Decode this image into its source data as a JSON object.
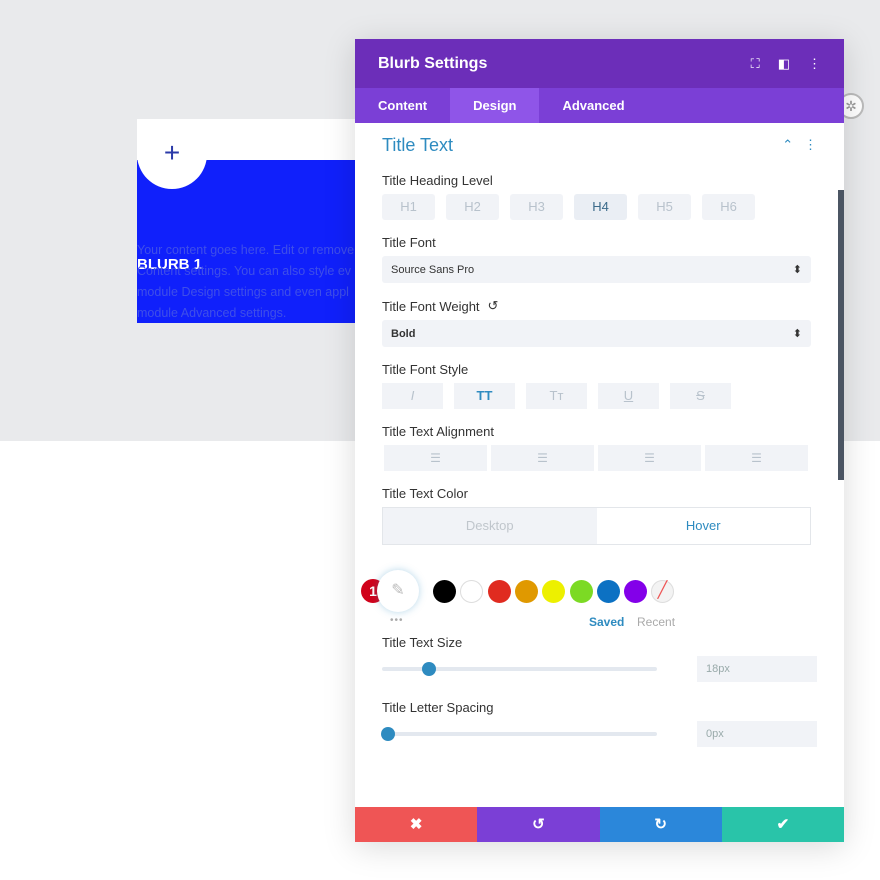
{
  "page": {
    "blurb_title": "BLURB 1",
    "blurb_lines": [
      "Your content goes here. Edit or remove",
      "Content settings. You can also style ev",
      "module Design settings and even appl",
      "module Advanced settings."
    ],
    "plus": "+"
  },
  "panel": {
    "title": "Blurb Settings",
    "tabs": [
      "Content",
      "Design",
      "Advanced"
    ],
    "active_tab": "Design",
    "section": "Title Text",
    "heading_label": "Title Heading Level",
    "headings": [
      "H1",
      "H2",
      "H3",
      "H4",
      "H5",
      "H6"
    ],
    "active_heading": "H4",
    "font_label": "Title Font",
    "font_value": "Source Sans Pro",
    "weight_label": "Title Font Weight",
    "weight_value": "Bold",
    "style_label": "Title Font Style",
    "styles": [
      "I",
      "TT",
      "Tт",
      "U",
      "S"
    ],
    "active_style": "TT",
    "align_label": "Title Text Alignment",
    "color_label": "Title Text Color",
    "color_tabs": [
      "Desktop",
      "Hover"
    ],
    "active_color_tab": "Hover",
    "badge": "1",
    "swatches": [
      "#000000",
      "#ffffff",
      "#e02b20",
      "#e09900",
      "#edf000",
      "#7cda24",
      "#0c71c3",
      "#8300e9"
    ],
    "saved": "Saved",
    "recent": "Recent",
    "dots": "•••",
    "size_label": "Title Text Size",
    "size_value": "18px",
    "size_percent": 17,
    "spacing_label": "Title Letter Spacing",
    "spacing_value": "0px",
    "spacing_percent": 0
  },
  "colors": {
    "header": "#6c2eb9",
    "tabs": "#7b3fd6",
    "cancel": "#ef5555",
    "undo": "#7b3fd6",
    "redo": "#2b87da",
    "save": "#29c4a9",
    "blurb_bg": "#1020fb"
  }
}
